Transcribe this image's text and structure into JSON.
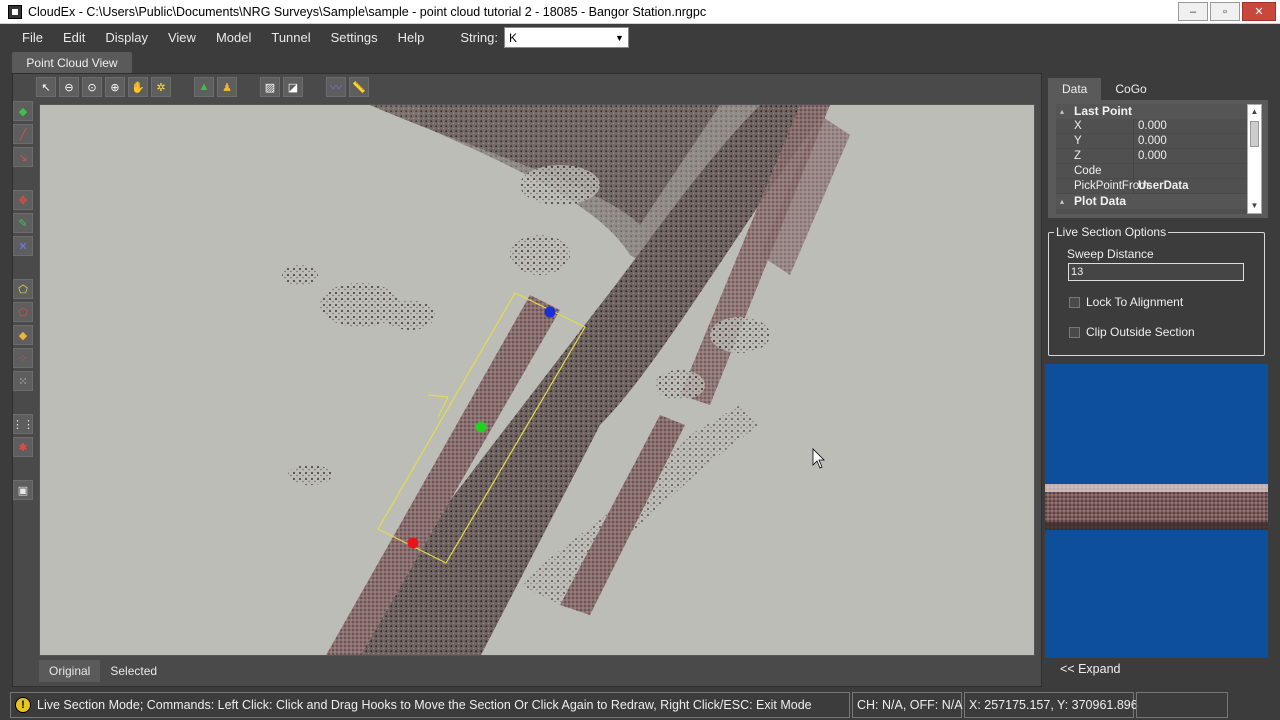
{
  "window": {
    "title": "CloudEx - C:\\Users\\Public\\Documents\\NRG Surveys\\Sample\\sample - point cloud tutorial 2 - 18085 - Bangor Station.nrgpc",
    "minimize": "–",
    "maximize": "▫",
    "close": "✕"
  },
  "menu": {
    "items": [
      "File",
      "Edit",
      "Display",
      "View",
      "Model",
      "Tunnel",
      "Settings",
      "Help"
    ],
    "string_label": "String:",
    "string_value": "K"
  },
  "view_tab": "Point Cloud View",
  "bottom_tabs": [
    "Original",
    "Selected"
  ],
  "right_tabs": [
    "Data",
    "CoGo"
  ],
  "data_panel": {
    "last_point_title": "Last Point",
    "rows": [
      {
        "key": "X",
        "value": "0.000"
      },
      {
        "key": "Y",
        "value": "0.000"
      },
      {
        "key": "Z",
        "value": "0.000"
      },
      {
        "key": "Code",
        "value": ""
      },
      {
        "key": "PickPointFrom",
        "value": "UserData"
      }
    ],
    "plot_data_title": "Plot Data"
  },
  "live_section": {
    "legend": "Live Section Options",
    "sweep_label": "Sweep Distance",
    "sweep_value": "13",
    "lock_label": "Lock To Alignment",
    "clip_label": "Clip Outside Section"
  },
  "expand_label": "<< Expand",
  "status": {
    "message": "Live Section Mode; Commands: Left Click: Click and Drag Hooks to Move the Section Or Click Again to Redraw, Right Click/ESC: Exit Mode",
    "ch_off": "CH: N/A, OFF: N/A",
    "coords": "X: 257175.157, Y: 370961.896"
  },
  "colors": {
    "viewport_bg": "#bdbdb8",
    "preview_bg": "#0e4f9b",
    "hook_blue": "#1a2fd6",
    "hook_green": "#22d11f",
    "hook_red": "#e8141a",
    "section_outline": "#e3dc4a"
  }
}
